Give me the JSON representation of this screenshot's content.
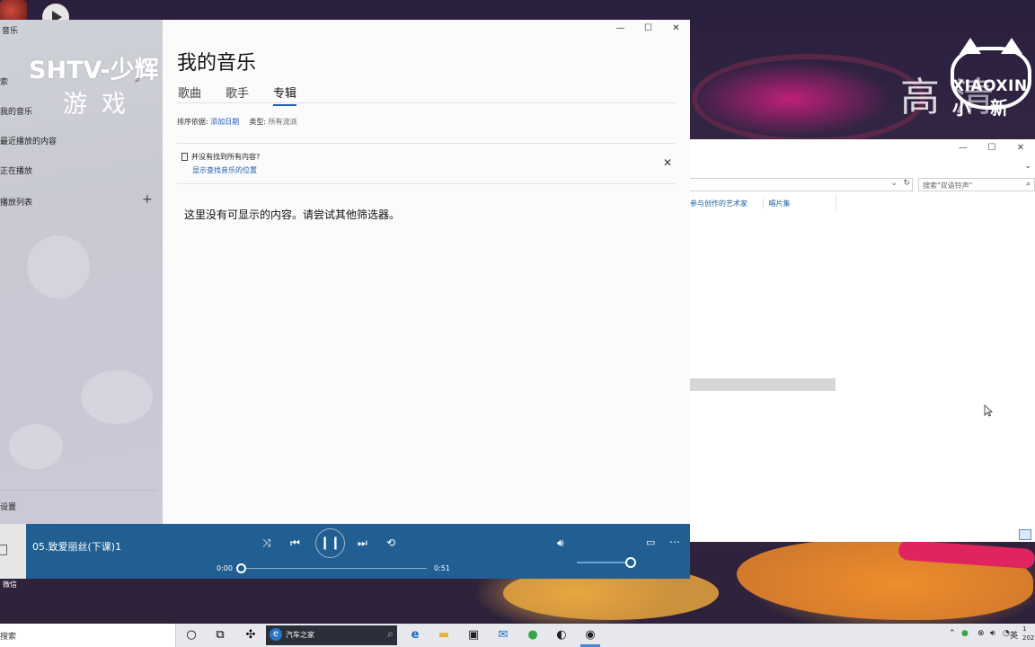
{
  "desktop": {
    "watermark_gao": "高",
    "watermark_qing": "清",
    "watermark_brand": "XIAOXIN",
    "watermark_brand_cn": "小新"
  },
  "explorer": {
    "search_placeholder": "搜索\"双语铃声\"",
    "col_contributing_artists": "参与创作的艺术家",
    "col_album": "唱片集"
  },
  "app": {
    "title": "音乐",
    "overlay_line1": "SHTV-少辉",
    "overlay_line2": "游戏",
    "search_fragment": "索",
    "nav": {
      "my_music": "我的音乐",
      "recent": "最近播放的内容",
      "now_playing": "正在播放",
      "playlists": "播放列表",
      "settings": "设置"
    },
    "page_title": "我的音乐",
    "tabs": [
      "歌曲",
      "歌手",
      "专辑"
    ],
    "active_tab": "专辑",
    "sort_label": "排序依据:",
    "sort_value": "添加日期",
    "type_label": "类型:",
    "type_value": "所有流派",
    "notice_text": "并没有找到所有内容?",
    "notice_link": "显示查找音乐的位置",
    "empty_message": "这里没有可显示的内容。请尝试其他筛选器。"
  },
  "player": {
    "track_title": "05.致爱丽丝(下课)1",
    "elapsed": "0:00",
    "duration": "0:51",
    "progress": 0.0,
    "volume": 0.9
  },
  "wechat_label": "微信",
  "taskbar": {
    "search_fragment": "搜索",
    "ie_tab_title": "汽车之家",
    "ime": "英",
    "clock_time": "1",
    "clock_date": "202"
  },
  "colors": {
    "player_bg": "#215f92",
    "accent": "#1f5fb0"
  }
}
